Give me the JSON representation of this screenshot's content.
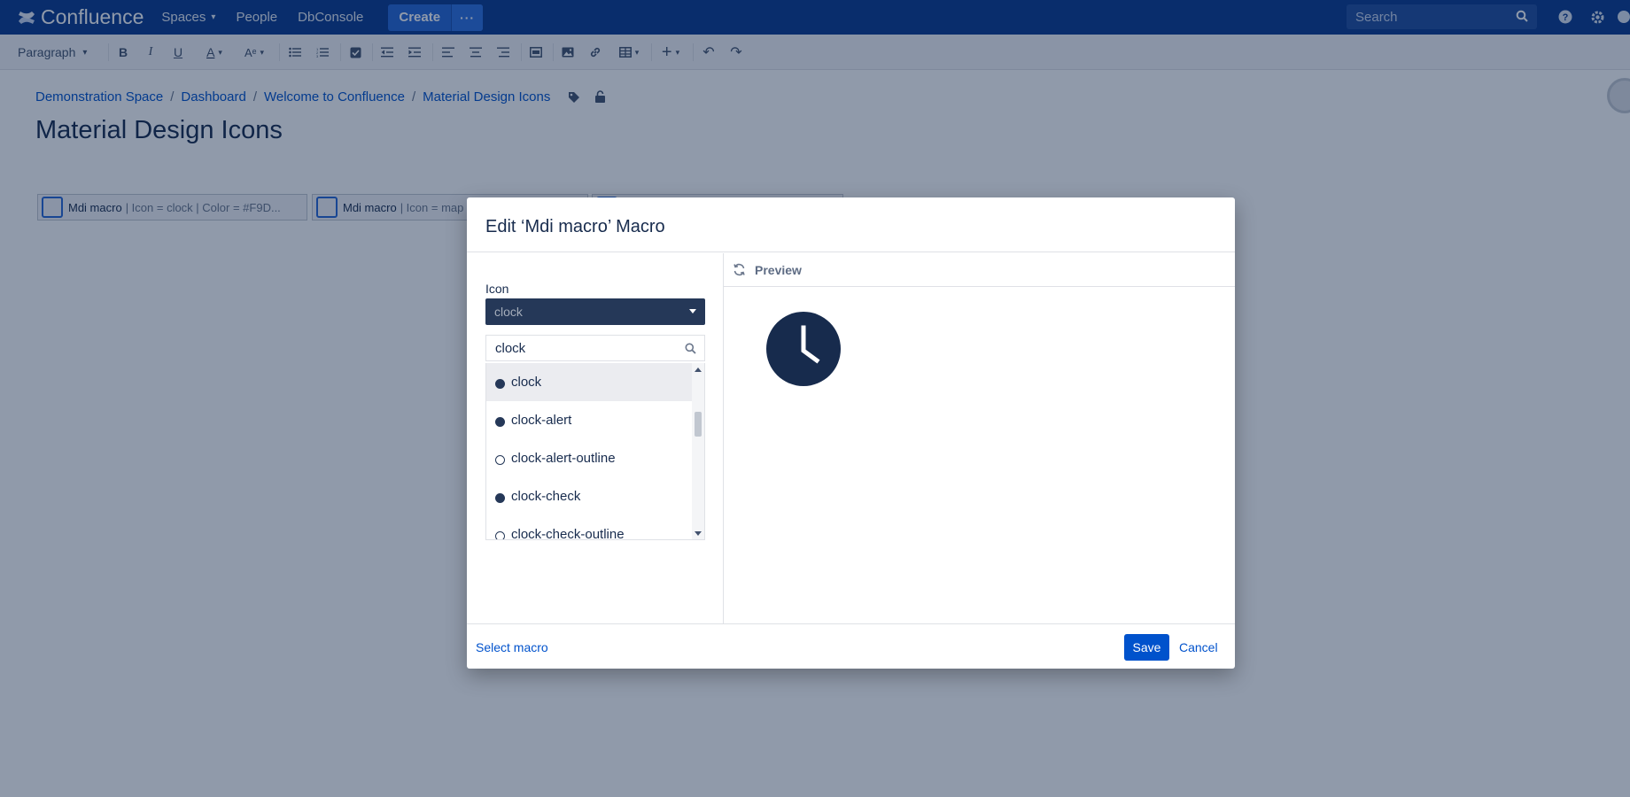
{
  "topnav": {
    "brand": "Confluence",
    "spaces": "Spaces",
    "people": "People",
    "dbconsole": "DbConsole",
    "create": "Create",
    "more": "···",
    "search_placeholder": "Search"
  },
  "toolbar": {
    "paragraph": "Paragraph"
  },
  "breadcrumb": {
    "items": [
      "Demonstration Space",
      "Dashboard",
      "Welcome to Confluence",
      "Material Design Icons"
    ]
  },
  "page": {
    "title": "Material Design Icons",
    "macros": [
      {
        "name": "Mdi macro",
        "params": "| Icon = clock | Color = #F9D..."
      },
      {
        "name": "Mdi macro",
        "params": "| Icon = map"
      }
    ]
  },
  "dialog": {
    "title": "Edit ‘Mdi macro’ Macro",
    "icon_label": "Icon",
    "selected_icon": "clock",
    "search_value": "clock",
    "options": [
      {
        "label": "clock",
        "icon": "clock-icon"
      },
      {
        "label": "clock-alert",
        "icon": "clock-alert-icon"
      },
      {
        "label": "clock-alert-outline",
        "icon": "clock-alert-outline-icon"
      },
      {
        "label": "clock-check",
        "icon": "clock-check-icon"
      },
      {
        "label": "clock-check-outline",
        "icon": "clock-check-outline-icon"
      }
    ],
    "preview_label": "Preview",
    "select_macro": "Select macro",
    "save": "Save",
    "cancel": "Cancel"
  },
  "colors": {
    "nav_bg": "#0a3a8e",
    "accent": "#0052cc",
    "icon_dark": "#253858"
  }
}
